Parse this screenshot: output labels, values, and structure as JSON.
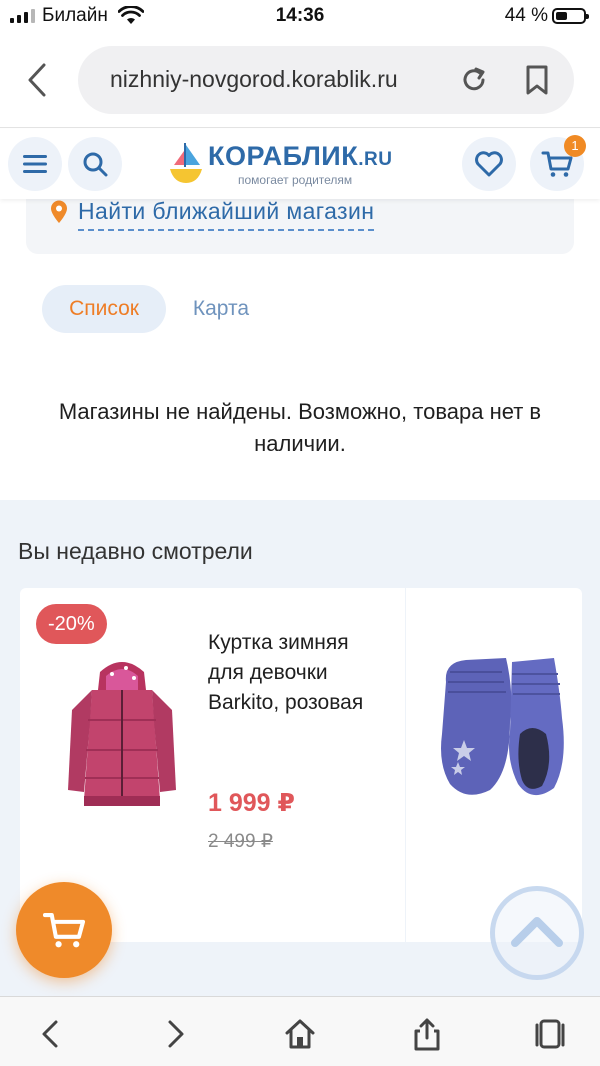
{
  "status_bar": {
    "carrier": "Билайн",
    "time": "14:36",
    "battery_percent": "44 %",
    "battery_level": 0.44
  },
  "browser": {
    "url": "nizhniy-novgorod.korablik.ru"
  },
  "header": {
    "logo_text": "КОРАБЛИК",
    "logo_domain": ".RU",
    "logo_tagline": "помогает родителям",
    "cart_count": "1"
  },
  "store_finder": {
    "link_label": "Найти ближайший магазин"
  },
  "tabs": [
    {
      "label": "Список",
      "active": true
    },
    {
      "label": "Карта",
      "active": false
    }
  ],
  "empty_message": "Магазины не найдены. Возможно, товара нет в наличии.",
  "recently_viewed": {
    "title": "Вы недавно смотрели",
    "products": [
      {
        "badge": "-20%",
        "name": "Куртка зимняя для девочки Barkito, розовая",
        "price": "1 999 ₽",
        "old_price": "2 499 ₽",
        "image": "pink-jacket"
      },
      {
        "image": "blue-mittens"
      }
    ]
  },
  "colors": {
    "brand_blue": "#2e6aa8",
    "accent_orange": "#ef8a2a",
    "discount_red": "#e0575a"
  }
}
